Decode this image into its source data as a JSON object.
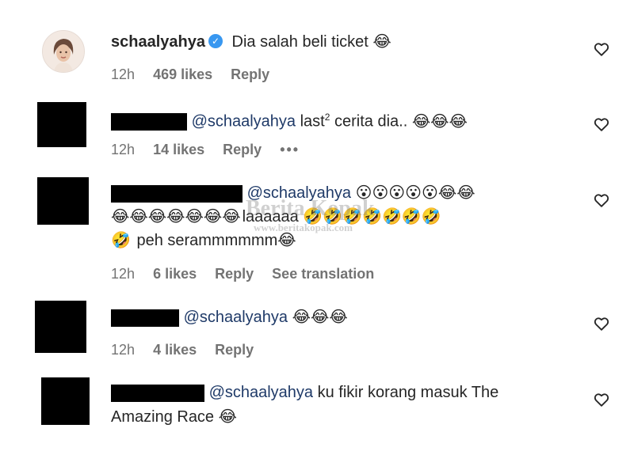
{
  "comments": [
    {
      "username": "schaalyahya",
      "text": "Dia salah beli ticket",
      "emoji": "😂",
      "time": "12h",
      "likes": "469 likes",
      "reply": "Reply"
    },
    {
      "mention": "@schaalyahya",
      "text_before_sup": "last",
      "sup": "2",
      "text_after_sup": " cerita dia..",
      "emojis": "😂😂😂",
      "time": "12h",
      "likes": "14 likes",
      "reply": "Reply",
      "more": "•••"
    },
    {
      "mention": "@schaalyahya",
      "line1_emojis": "😮😮😮😮😮😂😂",
      "line2_emojis_a": "😂😂😂😂😂😂😂",
      "line2_text": "laaaaaa",
      "line2_emojis_b": "🤣🤣🤣🤣🤣🤣🤣",
      "line3_emoji": "🤣",
      "line3_text": "peh serammmmmm",
      "line3_emoji_end": "😂",
      "time": "12h",
      "likes": "6 likes",
      "reply": "Reply",
      "translate": "See translation"
    },
    {
      "mention": "@schaalyahya",
      "emojis": "😂😂😂",
      "time": "12h",
      "likes": "4 likes",
      "reply": "Reply"
    },
    {
      "mention": "@schaalyahya",
      "text_line1": "ku fikir korang masuk The",
      "text_line2": "Amazing Race",
      "emoji": "😂"
    }
  ],
  "watermark": {
    "title": "Berita Kopak",
    "url": "www.beritakopak.com"
  },
  "icons": {
    "heart": "heart-outline-icon",
    "verified": "verified-badge-icon"
  }
}
